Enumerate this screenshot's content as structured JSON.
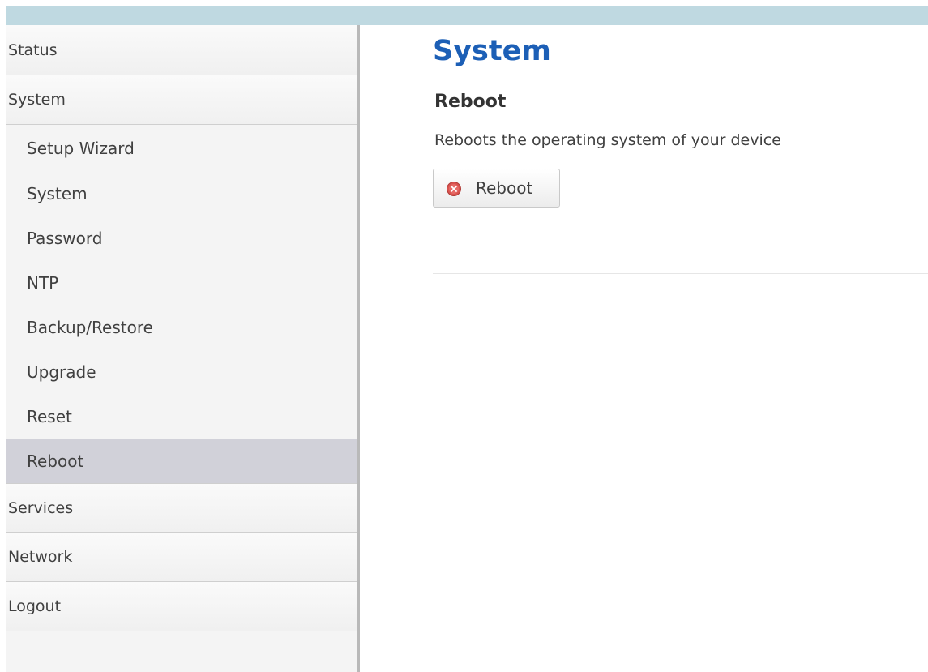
{
  "sidebar": {
    "top_items": [
      {
        "label": "Status"
      },
      {
        "label": "System"
      }
    ],
    "system_submenu": [
      {
        "label": "Setup Wizard"
      },
      {
        "label": "System"
      },
      {
        "label": "Password"
      },
      {
        "label": "NTP"
      },
      {
        "label": "Backup/Restore"
      },
      {
        "label": "Upgrade"
      },
      {
        "label": "Reset"
      },
      {
        "label": "Reboot",
        "active": true
      }
    ],
    "bottom_items": [
      {
        "label": "Services"
      },
      {
        "label": "Network"
      },
      {
        "label": "Logout"
      }
    ]
  },
  "main": {
    "page_title": "System",
    "section_title": "Reboot",
    "section_description": "Reboots the operating system of your device",
    "reboot_button": {
      "label": "Reboot",
      "icon": "stop-icon"
    }
  },
  "colors": {
    "title_blue": "#1c5fb6",
    "topbar": "#bfd9e1",
    "active_item": "#d1d1d9",
    "icon_red": "#d9534f"
  }
}
